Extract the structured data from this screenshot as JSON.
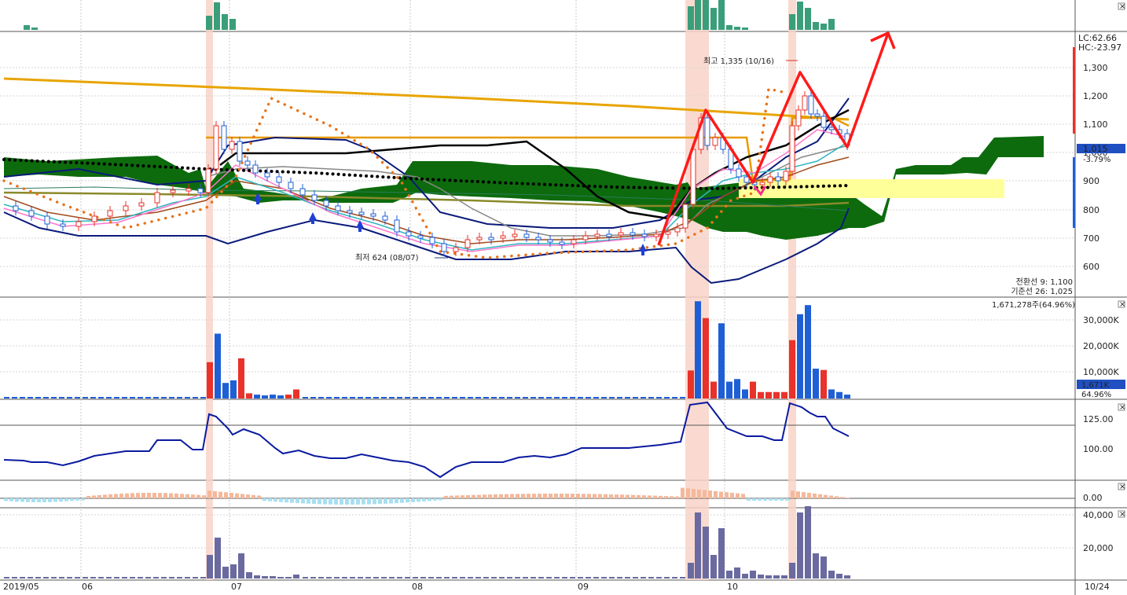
{
  "colors": {
    "up": "#e8322a",
    "down": "#1f5fd6",
    "cloud": "#0d6b0d",
    "yellow_line": "#e8a400",
    "orange_line": "#e89a00",
    "black_line": "#000000",
    "blue_line": "#0a1a7a",
    "highlight": "#f9d4c8",
    "yellow_box": "#ffff99",
    "red_arrow": "#ff1a1a",
    "teal": "#3a9e7a",
    "purple": "#6a6aa0",
    "lightblue": "#a8dff0",
    "salmon": "#f4b89a",
    "label_red": "#d62b2b",
    "label_blue": "#1f4fc0",
    "panel_bg": "#ffffff"
  },
  "price_panel": {
    "y_ticks": [
      "1,300",
      "1,200",
      "1,100",
      "1,000",
      "900",
      "800",
      "700",
      "600"
    ],
    "lc_label": "LC:62.66",
    "hc_label": "HC:-23.97",
    "current_price": "1,015",
    "current_change": "-3.79%",
    "high_label": "최고 1,335 (10/16)",
    "low_label": "최저 624 (08/07)",
    "conversion_line_label": "전환선 9: 1,100",
    "base_line_label": "기준선 26: 1,025"
  },
  "volume_panel": {
    "header": "1,671,278주(64.96%)",
    "y_ticks": [
      "30,000K",
      "20,000K",
      "10,000K"
    ],
    "current_value": "1,671K",
    "current_pct": "64.96%"
  },
  "indicator1": {
    "y_ticks": [
      "125.00",
      "100.00"
    ]
  },
  "indicator2": {
    "y_ticks": [
      "0.00"
    ]
  },
  "indicator3": {
    "y_ticks": [
      "40,000",
      "20,000"
    ]
  },
  "x_labels": [
    "2019/05",
    "06",
    "07",
    "08",
    "09",
    "10"
  ],
  "right_date": "10/24",
  "chart_data": {
    "type": "candlestick",
    "period": "2019/05 – 2019/10",
    "price_range": [
      500,
      1400
    ],
    "price_points": [
      {
        "date": "05 start",
        "close": 830
      },
      {
        "date": "06 start",
        "close": 720
      },
      {
        "date": "06 end",
        "close": 860
      },
      {
        "date": "07 early",
        "close": 1020
      },
      {
        "date": "07 mid",
        "close": 850
      },
      {
        "date": "08 early",
        "close": 660
      },
      {
        "date": "09",
        "close": 710
      },
      {
        "date": "09 end",
        "close": 690
      },
      {
        "date": "10 early",
        "close": 1150
      },
      {
        "date": "10 mid",
        "close": 930
      },
      {
        "date": "10/16",
        "close": 1300,
        "high": 1335
      },
      {
        "date": "10/24",
        "close": 1015
      }
    ],
    "high": {
      "date": "10/16",
      "value": 1335
    },
    "low": {
      "date": "08/07",
      "value": 624
    },
    "volume_range_K": [
      0,
      35000
    ],
    "indicator1_range": [
      80,
      140
    ],
    "indicator3_range": [
      0,
      45000
    ]
  }
}
